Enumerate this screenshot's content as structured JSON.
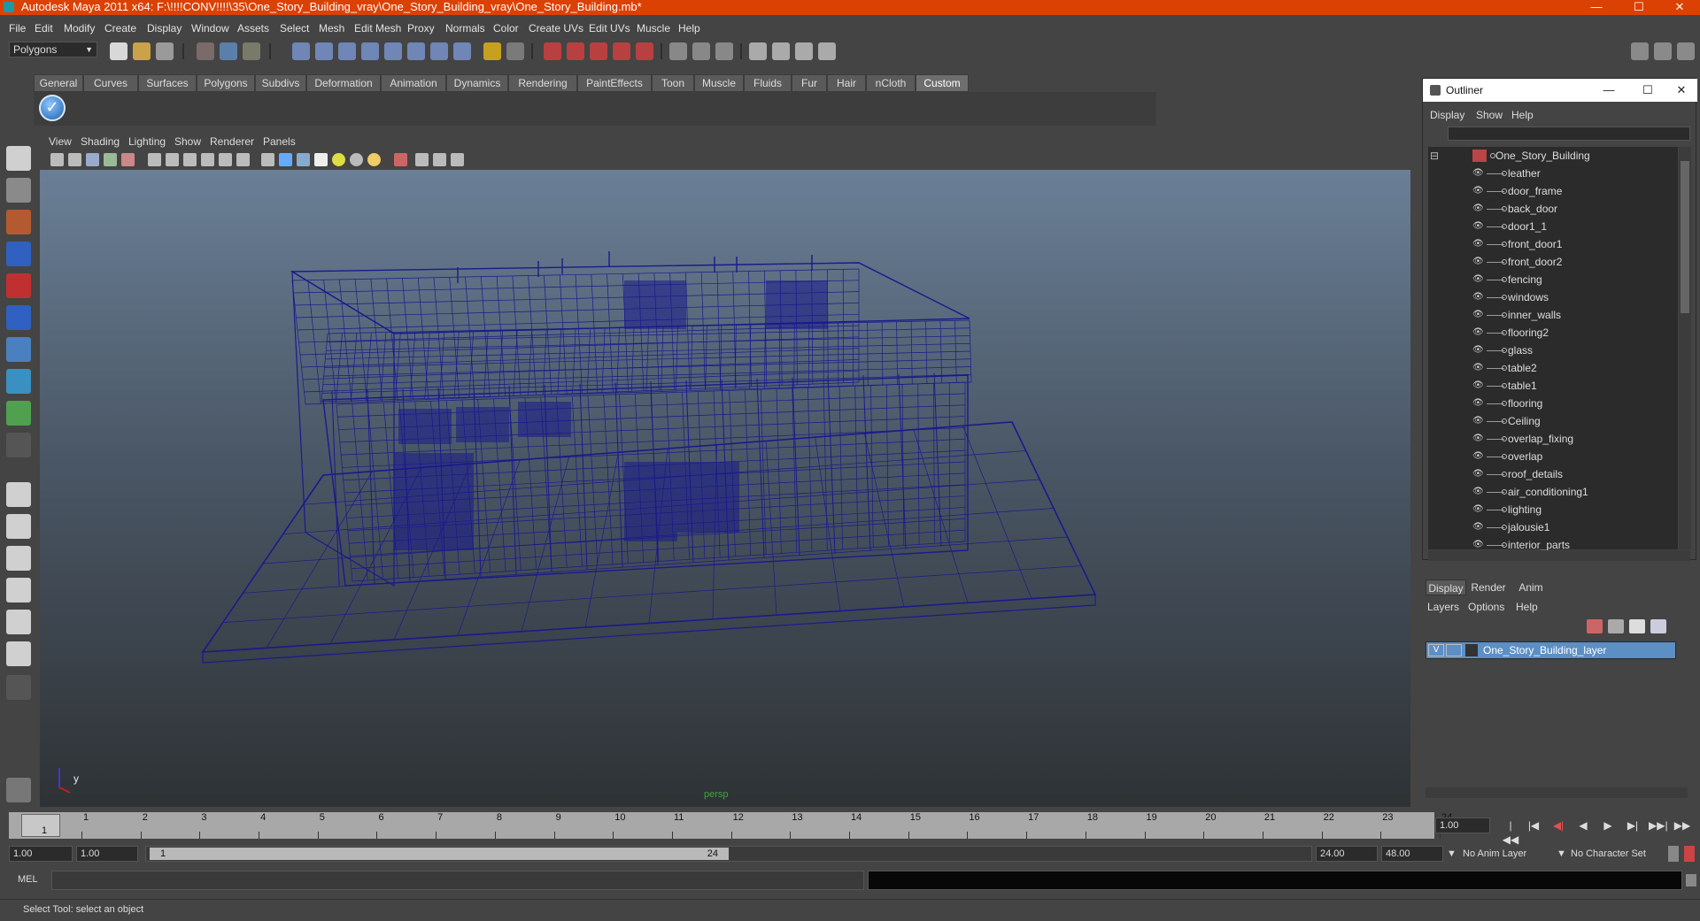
{
  "window": {
    "title": "Autodesk Maya 2011 x64: F:\\!!!!CONV!!!!\\35\\One_Story_Building_vray\\One_Story_Building_vray\\One_Story_Building.mb*",
    "minimize": "—",
    "maximize": "☐",
    "close": "✕"
  },
  "menubar": [
    "File",
    "Edit",
    "Modify",
    "Create",
    "Display",
    "Window",
    "Assets",
    "Select",
    "Mesh",
    "Edit Mesh",
    "Proxy",
    "Normals",
    "Color",
    "Create UVs",
    "Edit UVs",
    "Muscle",
    "Help"
  ],
  "status_line": {
    "mode": "Polygons"
  },
  "shelf": {
    "tabs": [
      "General",
      "Curves",
      "Surfaces",
      "Polygons",
      "Subdivs",
      "Deformation",
      "Animation",
      "Dynamics",
      "Rendering",
      "PaintEffects",
      "Toon",
      "Muscle",
      "Fluids",
      "Fur",
      "Hair",
      "nCloth",
      "Custom"
    ],
    "active_tab": "Custom",
    "check_glyph": "✓"
  },
  "viewport": {
    "menu": [
      "View",
      "Shading",
      "Lighting",
      "Show",
      "Renderer",
      "Panels"
    ],
    "camera_label": "persp",
    "axis_y": "y",
    "axis_x": "x",
    "wire_color": "#1a1a8c"
  },
  "outliner": {
    "title": "Outliner",
    "menu": [
      "Display",
      "Show",
      "Help"
    ],
    "root": "One_Story_Building",
    "items": [
      "leather",
      "door_frame",
      "back_door",
      "door1_1",
      "front_door1",
      "front_door2",
      "fencing",
      "windows",
      "inner_walls",
      "flooring2",
      "glass",
      "table2",
      "table1",
      "flooring",
      "Ceiling",
      "overlap_fixing",
      "overlap",
      "roof_details",
      "air_conditioning1",
      "lighting",
      "jalousie1",
      "interior_parts"
    ],
    "collapse_glyph": "⊟"
  },
  "layer_editor": {
    "tabs": [
      "Display",
      "Render",
      "Anim"
    ],
    "active_tab": "Display",
    "menu": [
      "Layers",
      "Options",
      "Help"
    ],
    "layer": {
      "visibility": "V",
      "name": "One_Story_Building_layer"
    }
  },
  "timeline": {
    "ticks": [
      "1",
      "2",
      "3",
      "4",
      "5",
      "6",
      "7",
      "8",
      "9",
      "10",
      "11",
      "12",
      "13",
      "14",
      "15",
      "16",
      "17",
      "18",
      "19",
      "20",
      "21",
      "22",
      "23",
      "24"
    ],
    "current_marker": "1",
    "current_frame": "1.00"
  },
  "range": {
    "start": "1.00",
    "playback_start": "1.00",
    "slider_start": "1",
    "slider_end": "24",
    "playback_end": "24.00",
    "end": "48.00",
    "anim_layer": "No Anim Layer",
    "character_set": "No Character Set"
  },
  "playback_glyphs": [
    "|◀◀",
    "|◀",
    "◀|",
    "◀",
    "▶",
    "▶|",
    "▶▶|",
    "▶▶"
  ],
  "command_line": {
    "label": "MEL"
  },
  "help_line": "Select Tool: select an object"
}
